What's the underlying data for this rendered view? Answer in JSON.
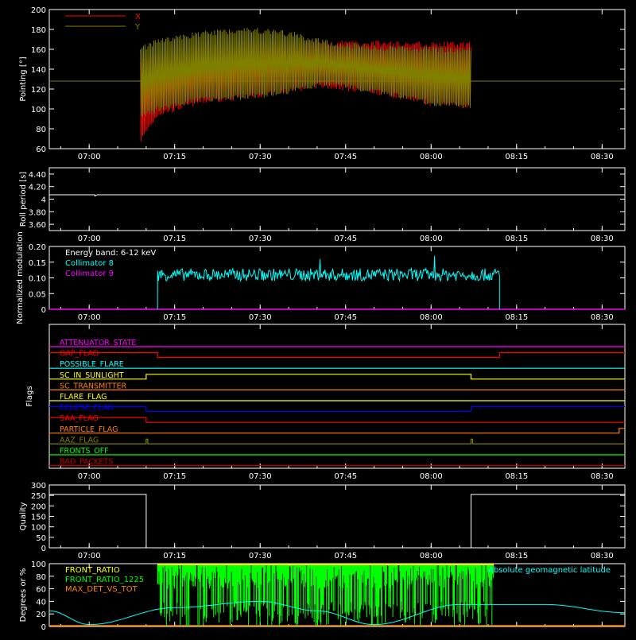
{
  "time_ticks": [
    "07:00",
    "07:15",
    "07:30",
    "07:45",
    "08:00",
    "08:15",
    "08:30"
  ],
  "colors": {
    "background": "#000000",
    "axes": "#ffffff",
    "red": "#ff0000",
    "olive": "#808000",
    "cyan": "#00ffff",
    "magenta": "#ff00ff",
    "yellow": "#ffff00",
    "orange": "#ff8000",
    "blue": "#0000ff",
    "green": "#00ff00",
    "dark_red": "#c00000"
  },
  "chart_data": [
    {
      "id": "pointing",
      "type": "line",
      "ylabel": "Pointing [°]",
      "ylim": [
        60,
        200
      ],
      "yticks": [
        60,
        80,
        100,
        120,
        140,
        160,
        180,
        200
      ],
      "xlim": [
        "06:53",
        "08:34"
      ],
      "legend": "top-left",
      "series": [
        {
          "name": "X",
          "color": "#ff0000",
          "x": [
            "07:09",
            "07:12",
            "07:20",
            "07:30",
            "07:40",
            "07:50",
            "08:00",
            "08:07"
          ],
          "y_max": [
            150,
            150,
            158,
            165,
            166,
            166,
            165,
            165
          ],
          "y_min": [
            68,
            95,
            108,
            114,
            124,
            118,
            106,
            104
          ]
        },
        {
          "name": "Y",
          "color": "#808000",
          "x": [
            "07:09",
            "07:12",
            "07:20",
            "07:28",
            "07:35",
            "07:42",
            "07:50",
            "08:00",
            "08:07"
          ],
          "y_max": [
            160,
            168,
            176,
            180,
            176,
            166,
            162,
            160,
            160
          ],
          "y_min": [
            92,
            100,
            110,
            112,
            118,
            126,
            118,
            106,
            102
          ]
        }
      ],
      "baseline": {
        "value": 128,
        "color": "#808000"
      }
    },
    {
      "id": "roll_period",
      "type": "line",
      "ylabel": "Roll period [s]",
      "ylim": [
        3.5,
        4.5
      ],
      "yticks": [
        3.6,
        3.8,
        4.0,
        4.2,
        4.4
      ],
      "series": [
        {
          "color": "#ffffff",
          "x": [
            "06:53",
            "07:13",
            "08:34"
          ],
          "y": [
            4.07,
            4.07,
            4.07
          ],
          "dip": {
            "x": "07:01",
            "y": 4.05
          }
        }
      ]
    },
    {
      "id": "modulation",
      "type": "line",
      "ylabel": "Normalized modulation",
      "ylim": [
        0,
        0.2
      ],
      "yticks": [
        0.0,
        0.05,
        0.1,
        0.15,
        0.2
      ],
      "annotation": "Energy band: 6-12 keV",
      "series": [
        {
          "name": "Collimator 8",
          "color": "#00ffff",
          "start": "07:12",
          "end": "08:12",
          "mean": 0.11,
          "spread": 0.02,
          "spikes": [
            0.16,
            0.17,
            0.16,
            0.17,
            0.16,
            0.17,
            0.16
          ]
        },
        {
          "name": "Collimator 9",
          "color": "#ff00ff",
          "y": 0.0
        }
      ]
    },
    {
      "id": "flags",
      "type": "line",
      "ylabel": "Flags",
      "flags": [
        {
          "label": "ATTENUATOR_STATE",
          "color": "#ff00ff",
          "steps": []
        },
        {
          "label": "GAP_FLAG",
          "color": "#ff0000",
          "steps": [
            {
              "from": "06:53",
              "to": "07:12",
              "high": 1
            },
            {
              "from": "08:12",
              "to": "08:34",
              "high": 1
            }
          ]
        },
        {
          "label": "POSSIBLE_FLARE",
          "color": "#00ffff",
          "steps": []
        },
        {
          "label": "SC_IN_SUNLIGHT",
          "color": "#ffff00",
          "steps": [
            {
              "from": "07:10",
              "to": "08:07",
              "high": 1
            }
          ]
        },
        {
          "label": "SC_TRANSMITTER",
          "color": "#ff8000",
          "steps": []
        },
        {
          "label": "FLARE_FLAG",
          "color": "#ffff00",
          "steps": []
        },
        {
          "label": "ECLIPSE_FLAG",
          "color": "#0000ff",
          "steps": [
            {
              "from": "06:53",
              "to": "07:10",
              "high": 1
            },
            {
              "from": "08:07",
              "to": "08:34",
              "high": 1
            }
          ]
        },
        {
          "label": "SAA_FLAG",
          "color": "#ff0000",
          "steps": [
            {
              "from": "06:53",
              "to": "07:10",
              "high": 1
            }
          ]
        },
        {
          "label": "PARTICLE_FLAG",
          "color": "#ff8000",
          "steps": [
            {
              "from": "08:33",
              "to": "08:34",
              "high": 1
            }
          ]
        },
        {
          "label": "AAZ_FLAG",
          "color": "#808000",
          "steps": [
            {
              "from": "07:10",
              "to": "07:10",
              "high": 1
            },
            {
              "from": "08:07",
              "to": "08:07",
              "high": 1
            }
          ]
        },
        {
          "label": "FRONTS_OFF",
          "color": "#00ff00",
          "steps": []
        },
        {
          "label": "BAD_PACKETS",
          "color": "#c00000",
          "steps": []
        }
      ]
    },
    {
      "id": "quality",
      "type": "line",
      "ylabel": "Quality",
      "ylim": [
        0,
        300
      ],
      "yticks": [
        0,
        50,
        100,
        150,
        200,
        250,
        300
      ],
      "series": [
        {
          "color": "#ffffff",
          "x": [
            "06:53",
            "07:10",
            "07:10",
            "08:07",
            "08:07",
            "08:34"
          ],
          "y": [
            255,
            255,
            0,
            0,
            255,
            255
          ]
        }
      ]
    },
    {
      "id": "ratios",
      "type": "line",
      "ylabel": "Degrees or %",
      "ylim": [
        0,
        100
      ],
      "yticks": [
        0,
        20,
        40,
        60,
        80,
        100
      ],
      "legend": "top-left",
      "annotation": "Absolute geomagnetic latitude",
      "series": [
        {
          "name": "FRONT_RATIO",
          "color": "#ffff00",
          "start": "07:12",
          "end": "08:11",
          "level": 100
        },
        {
          "name": "FRONT_RATIO_1225",
          "color": "#00ff00",
          "start": "07:12",
          "end": "08:11",
          "level": 100
        },
        {
          "name": "MAX_DET_VS_TOT",
          "color": "#ff8000",
          "level": 0
        },
        {
          "name": "Absolute geomagnetic latitude",
          "color": "#00ffff",
          "x": [
            "06:53",
            "07:00",
            "07:15",
            "07:30",
            "07:40",
            "07:50",
            "08:05",
            "08:20",
            "08:34"
          ],
          "y": [
            25,
            3,
            30,
            40,
            25,
            3,
            35,
            35,
            22
          ]
        }
      ]
    }
  ]
}
